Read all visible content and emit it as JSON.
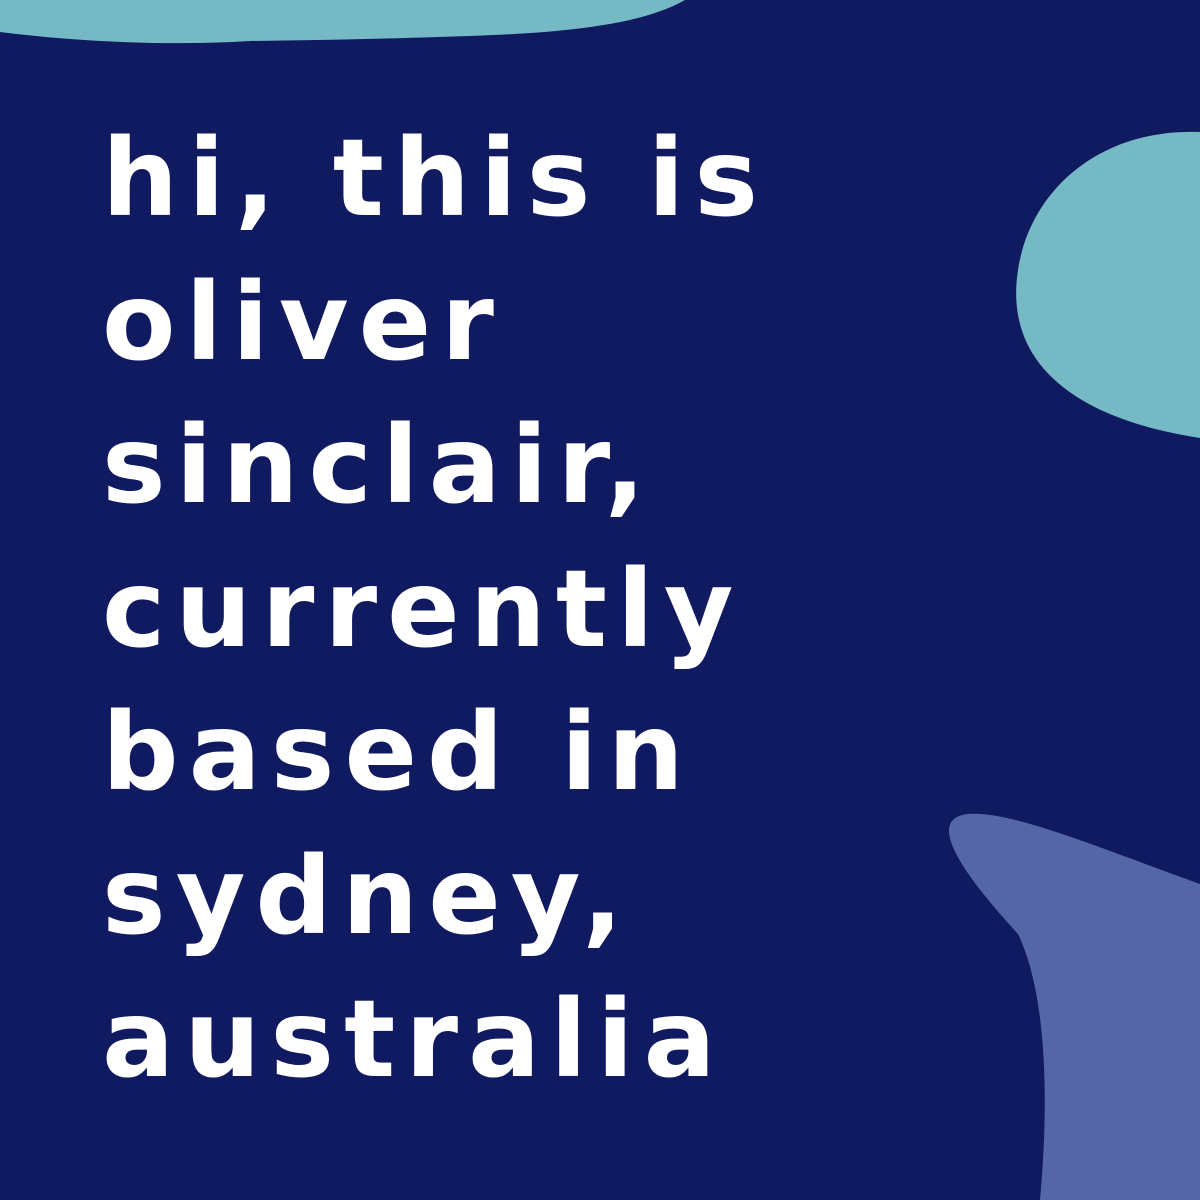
{
  "colors": {
    "background": "#101a60",
    "blob_teal": "#75b9c4",
    "blob_periwinkle": "#5566a8",
    "text": "#ffffff"
  },
  "message": {
    "lines": [
      "hi, this is",
      "oliver",
      "sinclair,",
      "currently",
      "based in",
      "sydney,",
      "australia"
    ]
  }
}
